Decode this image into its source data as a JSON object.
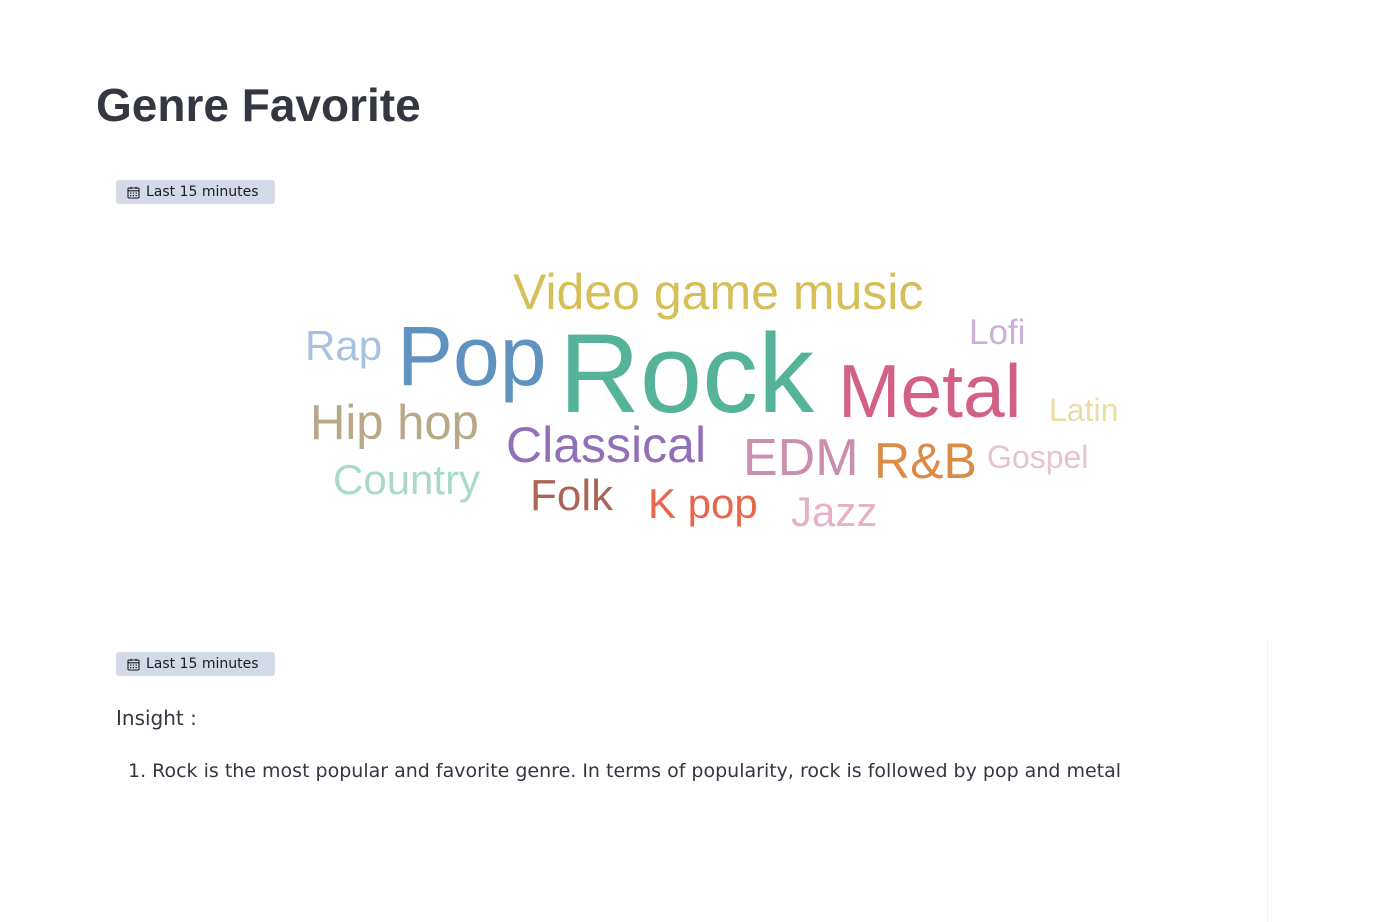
{
  "page": {
    "title": "Genre Favorite"
  },
  "wordcloud_panel": {
    "time_range": "Last 15 minutes",
    "icon": "calendar-icon"
  },
  "markdown_panel": {
    "time_range": "Last 15 minutes",
    "icon": "calendar-icon",
    "heading": "Insight :",
    "items": [
      {
        "number": "1.",
        "text": "Rock is the most popular and favorite genre. In terms of popularity, rock is followed by pop and metal"
      }
    ]
  },
  "words": [
    {
      "text": "Video game music",
      "color": "#d6bf57"
    },
    {
      "text": "Rap",
      "color": "#a7c2e0"
    },
    {
      "text": "Pop",
      "color": "#6092c0"
    },
    {
      "text": "Rock",
      "color": "#54b399"
    },
    {
      "text": "Lofi",
      "color": "#cbaed9"
    },
    {
      "text": "Metal",
      "color": "#d36086"
    },
    {
      "text": "Latin",
      "color": "#ebdca1"
    },
    {
      "text": "Hip hop",
      "color": "#b9a888"
    },
    {
      "text": "Classical",
      "color": "#9170b8"
    },
    {
      "text": "EDM",
      "color": "#ca8eae"
    },
    {
      "text": "R&B",
      "color": "#da8b45"
    },
    {
      "text": "Gospel",
      "color": "#e7c2d3"
    },
    {
      "text": "Country",
      "color": "#aad9cc"
    },
    {
      "text": "Folk",
      "color": "#aa6556"
    },
    {
      "text": "K pop",
      "color": "#e7664c"
    },
    {
      "text": "Jazz",
      "color": "#e8b0c7"
    }
  ]
}
